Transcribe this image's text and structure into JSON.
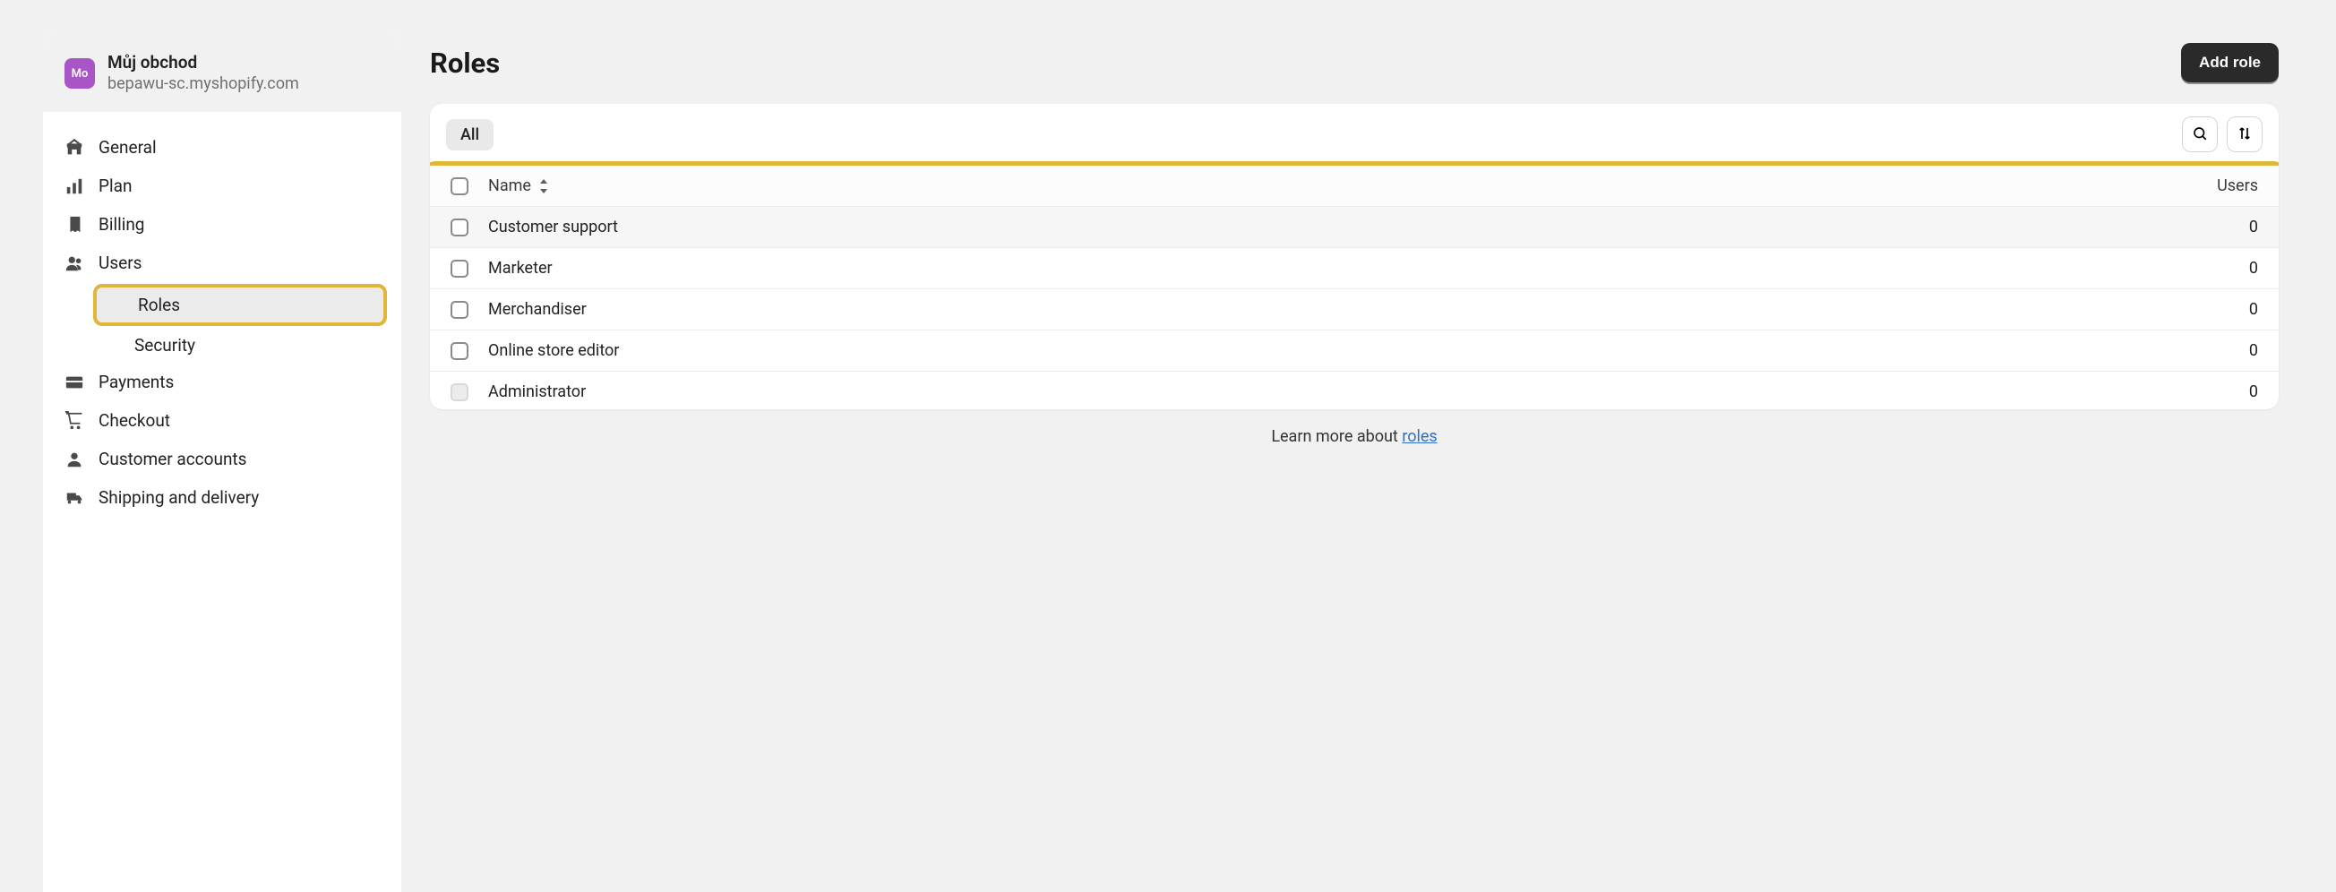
{
  "store": {
    "avatar_initials": "Mo",
    "name": "Můj obchod",
    "domain": "bepawu-sc.myshopify.com"
  },
  "sidebar": {
    "items": {
      "general": "General",
      "plan": "Plan",
      "billing": "Billing",
      "users": "Users",
      "roles": "Roles",
      "security": "Security",
      "payments": "Payments",
      "checkout": "Checkout",
      "customer_accounts": "Customer accounts",
      "shipping": "Shipping and delivery"
    }
  },
  "page": {
    "title": "Roles",
    "add_role_label": "Add role"
  },
  "table": {
    "filter_all": "All",
    "col_name": "Name",
    "col_users": "Users",
    "rows": [
      {
        "name": "Customer support",
        "users": "0",
        "hover": true,
        "disabled": false
      },
      {
        "name": "Marketer",
        "users": "0",
        "hover": false,
        "disabled": false
      },
      {
        "name": "Merchandiser",
        "users": "0",
        "hover": false,
        "disabled": false
      },
      {
        "name": "Online store editor",
        "users": "0",
        "hover": false,
        "disabled": false
      },
      {
        "name": "Administrator",
        "users": "0",
        "hover": false,
        "disabled": true
      }
    ]
  },
  "footer": {
    "prefix": "Learn more about ",
    "link": "roles"
  }
}
